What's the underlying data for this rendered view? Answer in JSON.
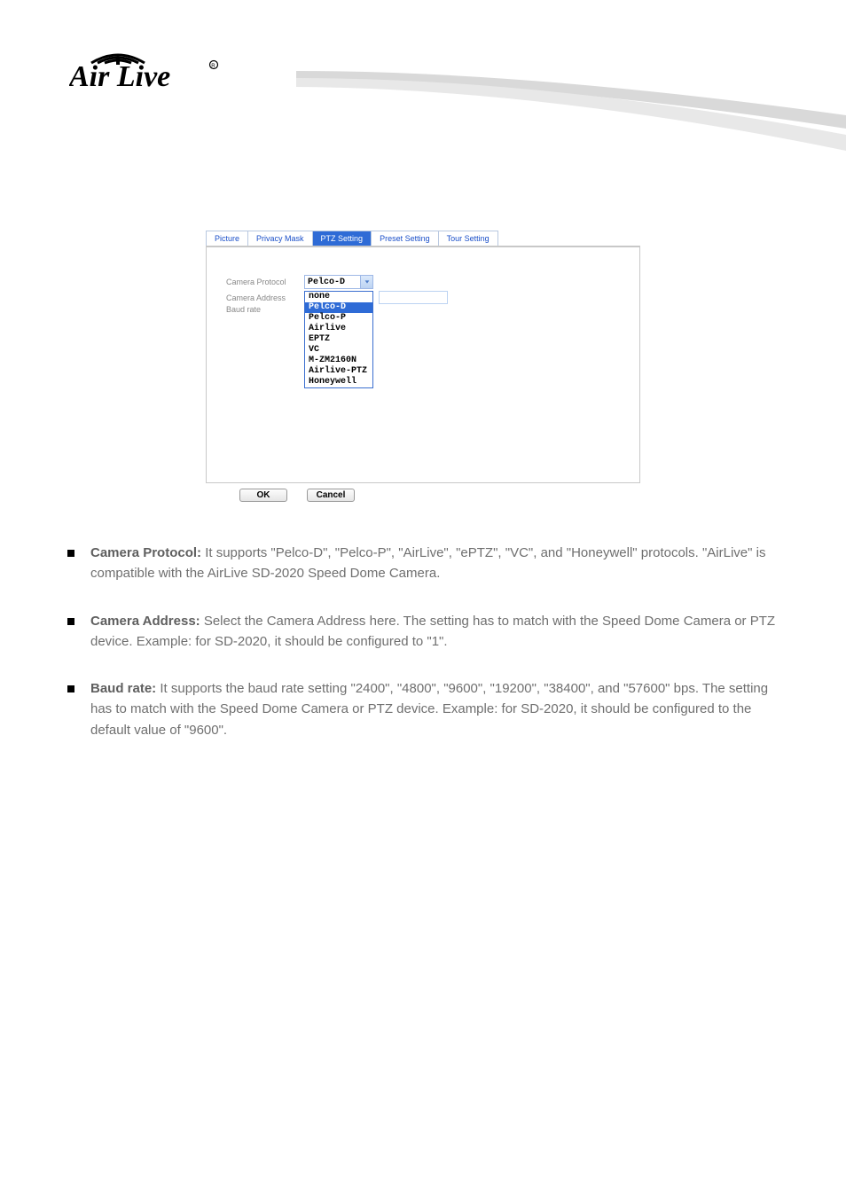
{
  "logo_alt": "AirLive",
  "tabs": {
    "picture": "Picture",
    "privacy": "Privacy Mask",
    "ptz": "PTZ Setting",
    "preset": "Preset Setting",
    "tour": "Tour Setting"
  },
  "form": {
    "protocol_label": "Camera Protocol",
    "protocol_value": "Pelco-D",
    "address_label": "Camera Address",
    "address_value": "",
    "baud_label": "Baud rate"
  },
  "options": {
    "o0": "none",
    "o1": "Pelco-D",
    "o2": "Pelco-P",
    "o3": "Airlive",
    "o4": "EPTZ",
    "o5": "VC",
    "o6": "M-ZM2160N",
    "o7": "Airlive-PTZ",
    "o8": "Honeywell"
  },
  "buttons": {
    "ok": "OK",
    "cancel": "Cancel"
  },
  "body": {
    "b1_title": "Camera Protocol:",
    "b1_text_after": " It supports \"Pelco-D\", \"Pelco-P\", \"AirLive\", \"ePTZ\", \"VC\", and \"Honeywell\" protocols. \"AirLive\" is compatible with the AirLive SD-2020 Speed Dome Camera.",
    "b2_title": "Camera Address:",
    "b2_text_after": " Select the Camera Address here. The setting has to match with the Speed Dome Camera or PTZ device. Example: for SD-2020, it should be configured to \"1\".",
    "b3_title": "Baud rate:",
    "b3_text_after": " It supports the baud rate setting \"2400\", \"4800\", \"9600\", \"19200\", \"38400\", and \"57600\" bps. The setting has to match with the Speed Dome Camera or PTZ device. Example: for SD-2020, it should be configured to the default value of \"9600\"."
  }
}
